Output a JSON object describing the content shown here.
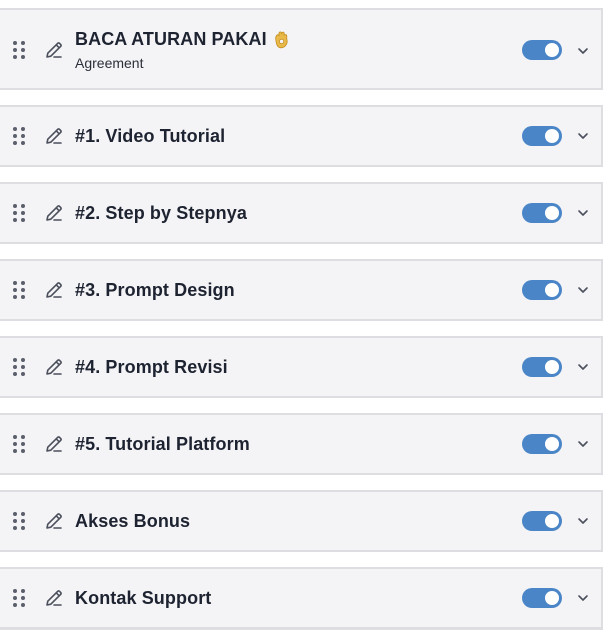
{
  "links": [
    {
      "title": "BACA ATURAN PAKAI",
      "subtitle": "Agreement",
      "emoji": "ok-hand-emoji",
      "enabled": true
    },
    {
      "title": "#1. Video Tutorial",
      "subtitle": "",
      "enabled": true
    },
    {
      "title": "#2. Step by Stepnya",
      "subtitle": "",
      "enabled": true
    },
    {
      "title": "#3. Prompt Design",
      "subtitle": "",
      "enabled": true
    },
    {
      "title": "#4. Prompt Revisi",
      "subtitle": "",
      "enabled": true
    },
    {
      "title": "#5. Tutorial Platform",
      "subtitle": "",
      "enabled": true
    },
    {
      "title": "Akses Bonus",
      "subtitle": "",
      "enabled": true
    },
    {
      "title": "Kontak Support",
      "subtitle": "",
      "enabled": true
    }
  ],
  "icons": {
    "drag": "drag-handle-icon",
    "edit": "pencil-icon",
    "expand": "chevron-down-icon"
  },
  "colors": {
    "row_background": "#f4f3f6",
    "row_border": "#dedde2",
    "toggle_on": "#4a86c7",
    "title_text": "#1d2330",
    "icon": "#5b5f6b"
  }
}
